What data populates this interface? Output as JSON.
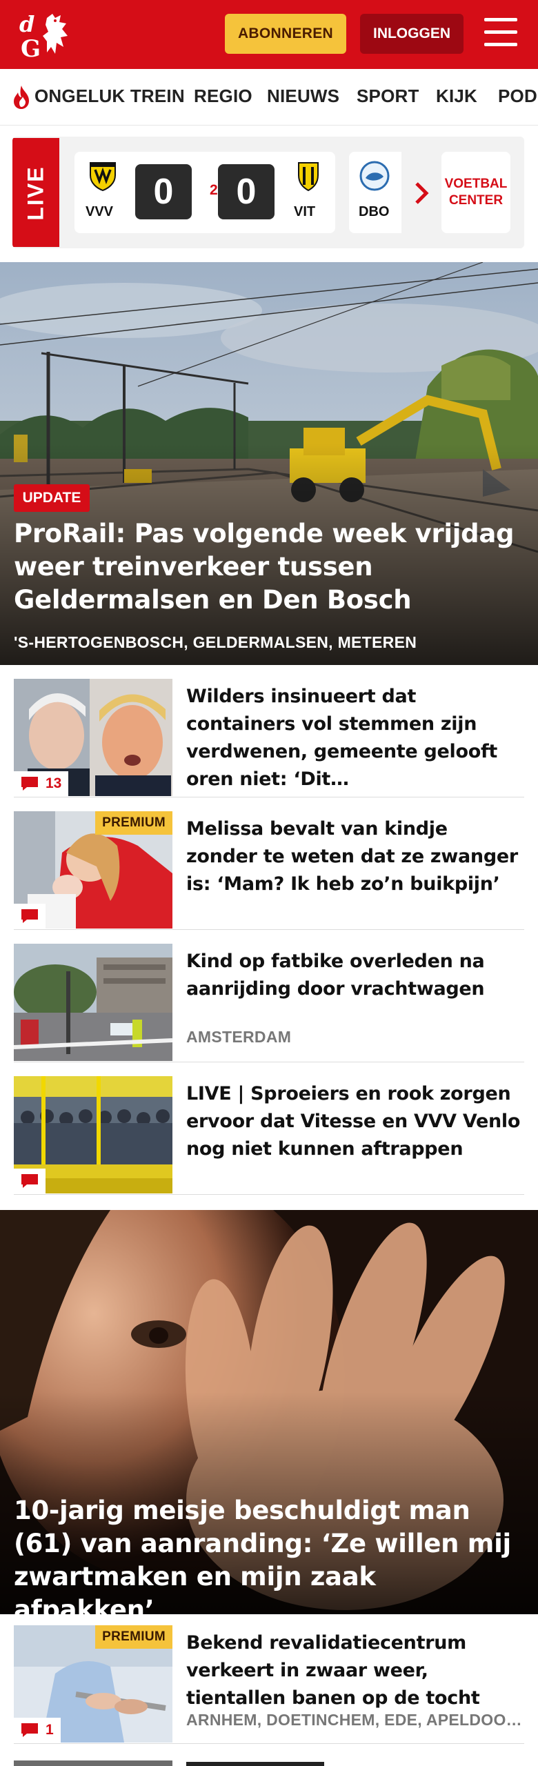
{
  "header": {
    "logo_text": "dG",
    "subscribe_label": "ABONNEREN",
    "login_label": "INLOGGEN",
    "brand_color": "#d50d17"
  },
  "nav": {
    "items": [
      "ONGELUK TREIN",
      "REGIO",
      "NIEUWS",
      "SPORT",
      "KIJK",
      "PODCAST"
    ]
  },
  "scoreboard": {
    "live_label": "LIVE",
    "match": {
      "home": "VVV",
      "away": "VIT",
      "home_score": "0",
      "away_score": "0",
      "minute": "2'"
    },
    "next_team": "DBO",
    "center_label_1": "VOETBAL",
    "center_label_2": "CENTER"
  },
  "hero": {
    "badge": "UPDATE",
    "title": "ProRail: Pas volgende week vrijdag weer treinverkeer tussen Geldermal­sen en Den Bosch",
    "location": "'S-HERTOGENBOSCH, GELDERMALSEN, METEREN"
  },
  "articles": [
    {
      "title": "Wilders insinueert dat containers vol stemmen zijn verdwenen, gemeente gelooft oren niet: ‘Dit…",
      "comments": "13",
      "location": "",
      "premium": ""
    },
    {
      "title": "Melissa bevalt van kindje zonder te weten dat ze zwanger is: ‘Mam? Ik heb zo’n buikpijn’",
      "comments": "",
      "location": "",
      "premium": "PREMIUM"
    },
    {
      "title": "Kind op fatbike overleden na aanrijding door vrachtwagen",
      "comments": "",
      "location": "AMSTERDAM",
      "premium": ""
    },
    {
      "title": "LIVE | Sproeiers en rook zorgen ervoor dat Vitesse en VVV Venlo nog niet kunnen aftrappen",
      "comments": "",
      "location": "",
      "premium": ""
    }
  ],
  "hero2": {
    "title": "10-jarig meisje beschuldigt man (61) van aanranding: ‘Ze willen mij zwartmaken en mijn zaak afpakken’"
  },
  "articles2": [
    {
      "title": "Bekend revalidatiecentrum verkeert in zwaar weer, tientallen banen op de tocht",
      "comments": "1",
      "location": "ARNHEM, DOETINCHEM, EDE, APELDOORN",
      "premium": "PREMIUM"
    }
  ]
}
